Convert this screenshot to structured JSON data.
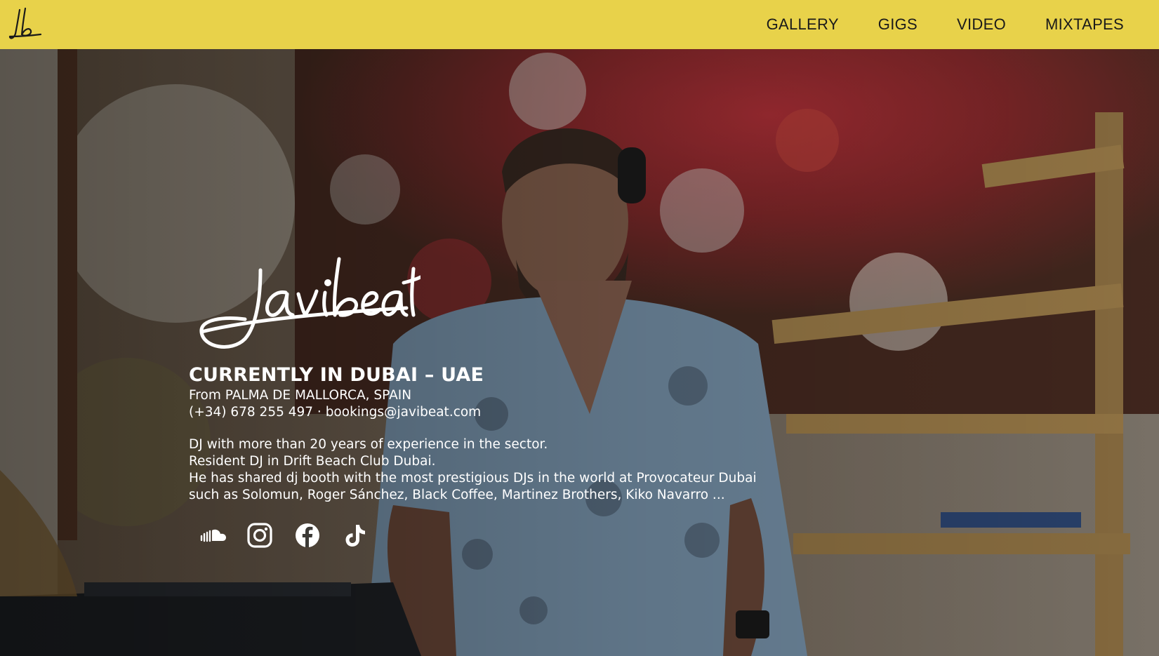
{
  "header": {
    "logo_text": "jb",
    "nav": [
      "GALLERY",
      "GIGS",
      "VIDEO",
      "MIXTAPES"
    ]
  },
  "hero": {
    "signature_text": "javibeat",
    "headline": "CURRENTLY IN DUBAI – UAE",
    "from": "From PALMA DE MALLORCA, SPAIN",
    "contact": "(+34) 678 255 497 · bookings@javibeat.com",
    "bio": [
      "DJ with more than 20 years of experience in the sector.",
      "Resident DJ in Drift Beach Club Dubai.",
      "He has shared dj booth with the most prestigious DJs in the world at Provocateur Dubai",
      "such as Solomun, Roger Sánchez, Black Coffee, Martinez Brothers, Kiko Navarro ..."
    ],
    "socials": [
      "soundcloud-icon",
      "instagram-icon",
      "facebook-icon",
      "tiktok-icon"
    ]
  },
  "colors": {
    "header_bg": "#e8d24a",
    "text": "#ffffff"
  }
}
